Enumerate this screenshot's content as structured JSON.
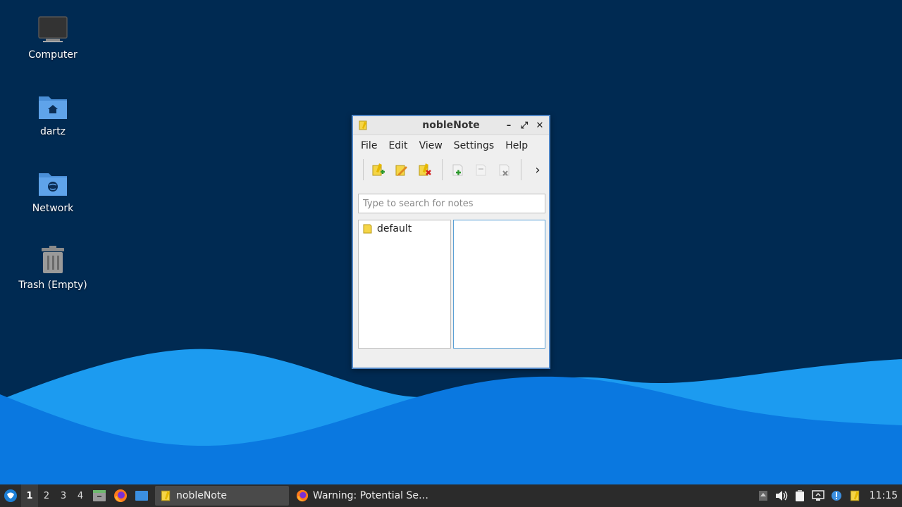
{
  "desktop": {
    "icons": [
      {
        "label": "Computer",
        "icon": "computer-icon"
      },
      {
        "label": "dartz",
        "icon": "home-folder-icon"
      },
      {
        "label": "Network",
        "icon": "network-folder-icon"
      },
      {
        "label": "Trash (Empty)",
        "icon": "trash-icon"
      }
    ]
  },
  "window": {
    "title": "nobleNote",
    "menu": [
      "File",
      "Edit",
      "View",
      "Settings",
      "Help"
    ],
    "toolbar": [
      "new-folder-icon",
      "rename-folder-icon",
      "delete-folder-icon",
      "new-note-icon",
      "rename-note-icon",
      "delete-note-icon"
    ],
    "toolbar_more": "›",
    "search": {
      "placeholder": "Type to search for notes",
      "value": ""
    },
    "folders": [
      {
        "label": "default"
      }
    ]
  },
  "taskbar": {
    "workspaces": [
      "1",
      "2",
      "3",
      "4"
    ],
    "active_workspace": "1",
    "tasks": [
      {
        "label": "nobleNote",
        "icon": "notebook-icon",
        "active": true
      },
      {
        "label": "Warning: Potential Se…",
        "icon": "firefox-icon",
        "active": false
      }
    ],
    "clock": "11:15"
  },
  "colors": {
    "desktop_bg": "#002a52",
    "wave_light": "#1c9bf0",
    "wave_dark": "#0a78e0",
    "window_border": "#4f86c6",
    "taskbar_bg": "#2b2b2b"
  }
}
